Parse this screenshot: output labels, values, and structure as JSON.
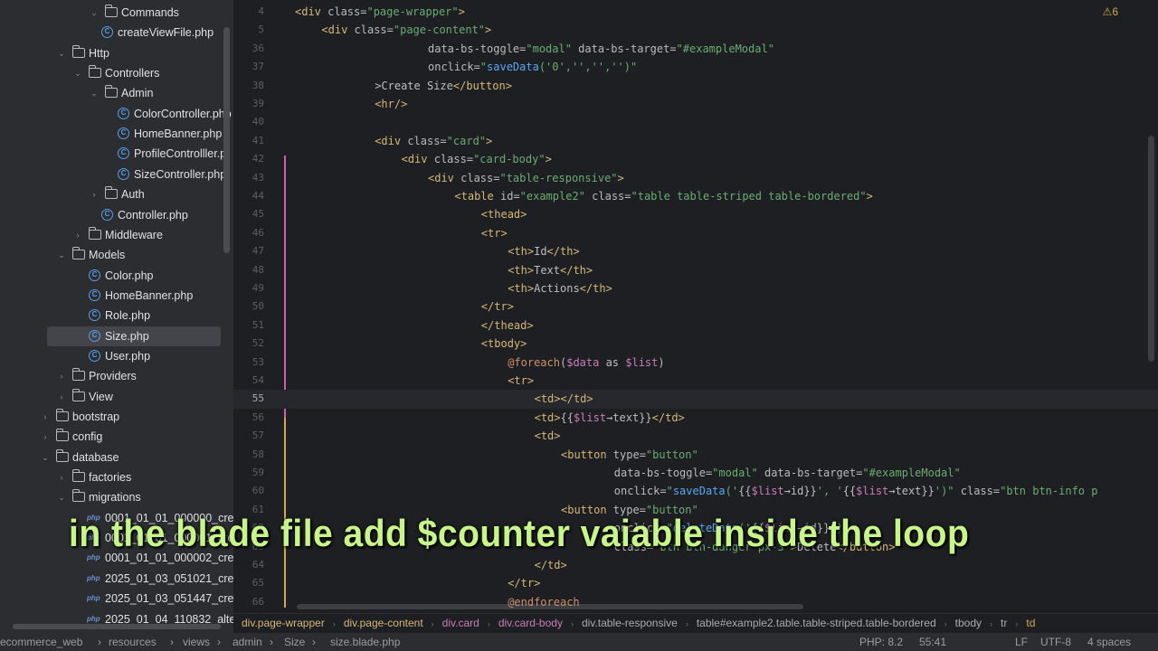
{
  "sidebar": {
    "items": [
      {
        "label": "Commands",
        "type": "folder",
        "level": 5,
        "expanded": true
      },
      {
        "label": "createViewFile.php",
        "type": "class",
        "level": 6
      },
      {
        "label": "Http",
        "type": "folder",
        "level": 3,
        "expanded": true
      },
      {
        "label": "Controllers",
        "type": "folder",
        "level": 4,
        "expanded": true
      },
      {
        "label": "Admin",
        "type": "folder",
        "level": 5,
        "expanded": true
      },
      {
        "label": "ColorController.php",
        "type": "class",
        "level": 7
      },
      {
        "label": "HomeBanner.php",
        "type": "class",
        "level": 7
      },
      {
        "label": "ProfileControlller.p",
        "type": "class",
        "level": 7
      },
      {
        "label": "SizeController.php",
        "type": "class",
        "level": 7
      },
      {
        "label": "Auth",
        "type": "folder",
        "level": 5,
        "expanded": false
      },
      {
        "label": "Controller.php",
        "type": "class",
        "level": 6
      },
      {
        "label": "Middleware",
        "type": "folder",
        "level": 4,
        "expanded": false
      },
      {
        "label": "Models",
        "type": "folder",
        "level": 3,
        "expanded": true
      },
      {
        "label": "Color.php",
        "type": "class",
        "level": 5
      },
      {
        "label": "HomeBanner.php",
        "type": "class",
        "level": 5
      },
      {
        "label": "Role.php",
        "type": "class",
        "level": 5
      },
      {
        "label": "Size.php",
        "type": "class",
        "level": 5,
        "selected": true
      },
      {
        "label": "User.php",
        "type": "class",
        "level": 5
      },
      {
        "label": "Providers",
        "type": "folder",
        "level": 3,
        "expanded": false
      },
      {
        "label": "View",
        "type": "folder",
        "level": 3,
        "expanded": false
      },
      {
        "label": "bootstrap",
        "type": "folder",
        "level": 2,
        "expanded": false
      },
      {
        "label": "config",
        "type": "folder",
        "level": 2,
        "expanded": false
      },
      {
        "label": "database",
        "type": "folder",
        "level": 2,
        "expanded": true
      },
      {
        "label": "factories",
        "type": "folder",
        "level": 3,
        "expanded": false
      },
      {
        "label": "migrations",
        "type": "folder",
        "level": 3,
        "expanded": true
      },
      {
        "label": "0001_01_01_000000_crea",
        "type": "php",
        "level": 5
      },
      {
        "label": "0001_01_01_000001_crea",
        "type": "php",
        "level": 5
      },
      {
        "label": "0001_01_01_000002_crea",
        "type": "php",
        "level": 5
      },
      {
        "label": "2025_01_03_051021_crea",
        "type": "php",
        "level": 5
      },
      {
        "label": "2025_01_03_051447_cre",
        "type": "php",
        "level": 5
      },
      {
        "label": "2025_01_04_110832_alte",
        "type": "php",
        "level": 5
      }
    ],
    "php_badge": "php"
  },
  "editor": {
    "warning_count": "6",
    "lines": [
      {
        "n": "4",
        "segs": [
          [
            "tag",
            "<div "
          ],
          [
            "attr",
            "class="
          ],
          [
            "str",
            "\"page-wrapper\""
          ],
          [
            "tag",
            ">"
          ]
        ],
        "indent": 8
      },
      {
        "n": "5",
        "segs": [
          [
            "tag",
            "<div "
          ],
          [
            "attr",
            "class="
          ],
          [
            "str",
            "\"page-content\""
          ],
          [
            "tag",
            ">"
          ]
        ],
        "indent": 12
      },
      {
        "n": "36",
        "segs": [
          [
            "attr",
            "data-bs-toggle="
          ],
          [
            "str",
            "\"modal\" "
          ],
          [
            "attr",
            "data-bs-target="
          ],
          [
            "str",
            "\"#exampleModal\""
          ]
        ],
        "indent": 28
      },
      {
        "n": "37",
        "segs": [
          [
            "attr",
            "onclick="
          ],
          [
            "str",
            "\""
          ],
          [
            "fn",
            "saveData"
          ],
          [
            "str",
            "('0','','','')\""
          ]
        ],
        "indent": 28
      },
      {
        "n": "38",
        "segs": [
          [
            "txt",
            ">Create Size"
          ],
          [
            "tag",
            "</button>"
          ]
        ],
        "indent": 20
      },
      {
        "n": "39",
        "segs": [
          [
            "tag",
            "<hr/>"
          ]
        ],
        "indent": 20
      },
      {
        "n": "40",
        "segs": [],
        "indent": 0
      },
      {
        "n": "41",
        "segs": [
          [
            "tag",
            "<div "
          ],
          [
            "attr",
            "class="
          ],
          [
            "str",
            "\"card\""
          ],
          [
            "tag",
            ">"
          ]
        ],
        "indent": 20
      },
      {
        "n": "42",
        "segs": [
          [
            "tag",
            "<div "
          ],
          [
            "attr",
            "class="
          ],
          [
            "str",
            "\"card-body\""
          ],
          [
            "tag",
            ">"
          ]
        ],
        "indent": 24
      },
      {
        "n": "43",
        "segs": [
          [
            "tag",
            "<div "
          ],
          [
            "attr",
            "class="
          ],
          [
            "str",
            "\"table-responsive\""
          ],
          [
            "tag",
            ">"
          ]
        ],
        "indent": 28
      },
      {
        "n": "44",
        "segs": [
          [
            "tag",
            "<table "
          ],
          [
            "attr",
            "id="
          ],
          [
            "str",
            "\"example2\" "
          ],
          [
            "attr",
            "class="
          ],
          [
            "str",
            "\"table table-striped table-bordered\""
          ],
          [
            "tag",
            ">"
          ]
        ],
        "indent": 32
      },
      {
        "n": "45",
        "segs": [
          [
            "tag",
            "<thead>"
          ]
        ],
        "indent": 36
      },
      {
        "n": "46",
        "segs": [
          [
            "tag",
            "<tr>"
          ]
        ],
        "indent": 36
      },
      {
        "n": "47",
        "segs": [
          [
            "tag",
            "<th>"
          ],
          [
            "txt",
            "Id"
          ],
          [
            "tag",
            "</th>"
          ]
        ],
        "indent": 40
      },
      {
        "n": "48",
        "segs": [
          [
            "tag",
            "<th>"
          ],
          [
            "txt",
            "Text"
          ],
          [
            "tag",
            "</th>"
          ]
        ],
        "indent": 40
      },
      {
        "n": "49",
        "segs": [
          [
            "tag",
            "<th>"
          ],
          [
            "txt",
            "Actions"
          ],
          [
            "tag",
            "</th>"
          ]
        ],
        "indent": 40
      },
      {
        "n": "50",
        "segs": [
          [
            "tag",
            "</tr>"
          ]
        ],
        "indent": 36
      },
      {
        "n": "51",
        "segs": [
          [
            "tag",
            "</thead>"
          ]
        ],
        "indent": 36
      },
      {
        "n": "52",
        "segs": [
          [
            "tag",
            "<tbody>"
          ]
        ],
        "indent": 36
      },
      {
        "n": "53",
        "segs": [
          [
            "blade",
            "@foreach"
          ],
          [
            "txt",
            "("
          ],
          [
            "var",
            "$data"
          ],
          [
            "txt",
            " as "
          ],
          [
            "var",
            "$list"
          ],
          [
            "txt",
            ")"
          ]
        ],
        "indent": 40
      },
      {
        "n": "54",
        "segs": [
          [
            "tag",
            "<tr>"
          ]
        ],
        "indent": 40
      },
      {
        "n": "55",
        "segs": [
          [
            "tag",
            "<td></td>"
          ]
        ],
        "indent": 44,
        "current": true
      },
      {
        "n": "56",
        "segs": [
          [
            "tag",
            "<td>"
          ],
          [
            "txt",
            "{{"
          ],
          [
            "var",
            "$list"
          ],
          [
            "txt",
            "→text}}"
          ],
          [
            "tag",
            "</td>"
          ]
        ],
        "indent": 44
      },
      {
        "n": "57",
        "segs": [
          [
            "tag",
            "<td>"
          ]
        ],
        "indent": 44
      },
      {
        "n": "58",
        "segs": [
          [
            "tag",
            "<button "
          ],
          [
            "attr",
            "type="
          ],
          [
            "str",
            "\"button\""
          ]
        ],
        "indent": 48
      },
      {
        "n": "59",
        "segs": [
          [
            "attr",
            "data-bs-toggle="
          ],
          [
            "str",
            "\"modal\" "
          ],
          [
            "attr",
            "data-bs-target="
          ],
          [
            "str",
            "\"#exampleModal\""
          ]
        ],
        "indent": 56
      },
      {
        "n": "60",
        "segs": [
          [
            "attr",
            "onclick="
          ],
          [
            "str",
            "\""
          ],
          [
            "fn",
            "saveData"
          ],
          [
            "str",
            "('"
          ],
          [
            "txt",
            "{{"
          ],
          [
            "var",
            "$list"
          ],
          [
            "txt",
            "→id}}"
          ],
          [
            "str",
            "', '"
          ],
          [
            "txt",
            "{{"
          ],
          [
            "var",
            "$list"
          ],
          [
            "txt",
            "→text}}"
          ],
          [
            "str",
            "')\" "
          ],
          [
            "attr",
            "class="
          ],
          [
            "str",
            "\"btn btn-info p"
          ]
        ],
        "indent": 56
      },
      {
        "n": "61",
        "segs": [
          [
            "tag",
            "<button "
          ],
          [
            "attr",
            "type="
          ],
          [
            "str",
            "\"button\""
          ]
        ],
        "indent": 48
      },
      {
        "n": "62",
        "segs": [
          [
            "attr",
            "onclick="
          ],
          [
            "str",
            "\""
          ],
          [
            "fn",
            "deleteData"
          ],
          [
            "str",
            "('"
          ],
          [
            "txt",
            "{{"
          ],
          [
            "var",
            "$list"
          ],
          [
            "txt",
            "→id}}"
          ],
          [
            "str",
            "')\""
          ]
        ],
        "indent": 56
      },
      {
        "n": "63",
        "segs": [
          [
            "attr",
            "class="
          ],
          [
            "str",
            "\"btn btn-danger px-3\""
          ],
          [
            "tag",
            ">"
          ],
          [
            "txt",
            "Delete"
          ],
          [
            "tag",
            "</button>"
          ]
        ],
        "indent": 56
      },
      {
        "n": "64",
        "segs": [
          [
            "tag",
            "</td>"
          ]
        ],
        "indent": 44
      },
      {
        "n": "65",
        "segs": [
          [
            "tag",
            "</tr>"
          ]
        ],
        "indent": 40
      },
      {
        "n": "66",
        "segs": [
          [
            "blade",
            "@endforeach"
          ]
        ],
        "indent": 40
      }
    ]
  },
  "breadcrumb": [
    {
      "label": "div.page-wrapper",
      "color": "#d5b778"
    },
    {
      "label": "div.page-content",
      "color": "#d5b778"
    },
    {
      "label": "div.card",
      "color": "#c77dbb"
    },
    {
      "label": "div.card-body",
      "color": "#c77dbb"
    },
    {
      "label": "div.table-responsive",
      "color": "#a9abb0"
    },
    {
      "label": "table#example2.table.table-striped.table-bordered",
      "color": "#a9abb0"
    },
    {
      "label": "tbody",
      "color": "#a9abb0"
    },
    {
      "label": "tr",
      "color": "#a9abb0"
    },
    {
      "label": "td",
      "color": "#d0a94f"
    }
  ],
  "status": {
    "path": [
      "ecommerce_web",
      "resources",
      "views",
      "admin",
      "Size",
      "size.blade.php"
    ],
    "php_version": "PHP: 8.2",
    "cursor": "55:41",
    "line_sep": "LF",
    "encoding": "UTF-8",
    "indent": "4 spaces"
  },
  "caption": "in the blade file add $counter vaiable inside the loop",
  "colors": {
    "accent": "#c8f58a",
    "tag": "#d5b778",
    "string": "#6aab73",
    "function": "#56a8f5",
    "variable": "#c77dbb"
  }
}
